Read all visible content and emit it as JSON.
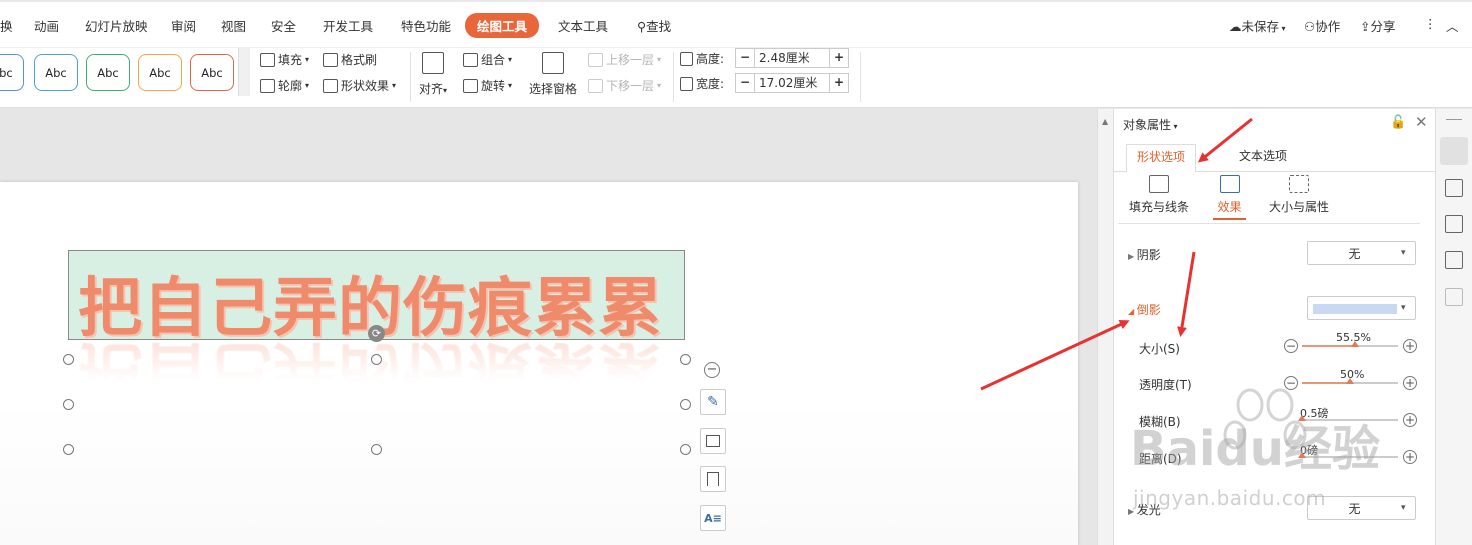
{
  "menubar": {
    "items": [
      {
        "label": "换"
      },
      {
        "label": "动画"
      },
      {
        "label": "幻灯片放映"
      },
      {
        "label": "审阅"
      },
      {
        "label": "视图"
      },
      {
        "label": "安全"
      },
      {
        "label": "开发工具"
      },
      {
        "label": "特色功能"
      },
      {
        "label": "绘图工具",
        "active": true
      },
      {
        "label": "文本工具"
      },
      {
        "label": "查找",
        "icon": "search-icon"
      }
    ],
    "right": {
      "unsaved": "未保存",
      "collab": "协作",
      "share": "分享",
      "more": "⋮",
      "collapse": "︿"
    },
    "accent_color": "#e8663a"
  },
  "ribbon": {
    "style_boxes": [
      {
        "label": "Abc",
        "color": "#5b8def"
      },
      {
        "label": "Abc",
        "color": "#4aa3c9"
      },
      {
        "label": "Abc",
        "color": "#39b07a"
      },
      {
        "label": "Abc",
        "color": "#f0a940"
      },
      {
        "label": "Abc",
        "color": "#e0664b"
      }
    ],
    "fill": "填充",
    "format_painter": "格式刷",
    "outline": "轮廓",
    "shape_effects": "形状效果",
    "align": "对齐",
    "group": "组合",
    "rotate": "旋转",
    "selection_pane": "选择窗格",
    "bring_forward": "上移一层",
    "send_backward": "下移一层",
    "height_label": "高度:",
    "height_value": "2.48厘米",
    "width_label": "宽度:",
    "width_value": "17.02厘米",
    "minus": "−",
    "plus": "+"
  },
  "canvas": {
    "text": "把自己弄的伤痕累累",
    "text_color": "#ef8a6b",
    "box_fill": "#d8efe4"
  },
  "panel": {
    "title": "对象属性",
    "tabs": {
      "shape": "形状选项",
      "text": "文本选项"
    },
    "subtabs": {
      "fill_line": "填充与线条",
      "effects": "效果",
      "size_props": "大小与属性"
    },
    "shadow": {
      "label": "阴影",
      "value": "无"
    },
    "reflection": {
      "label": "倒影",
      "swatch_color": "#c9d8f3",
      "size": {
        "label": "大小(S)",
        "value": "55.5%",
        "fraction": 0.555
      },
      "transparency": {
        "label": "透明度(T)",
        "value": "50%",
        "fraction": 0.5
      },
      "blur": {
        "label": "模糊(B)",
        "value": "0.5磅",
        "fraction": 0.0
      },
      "distance": {
        "label": "距离(D)",
        "value": "0磅",
        "fraction": 0.0
      }
    },
    "glow": {
      "label": "发光",
      "value": "无"
    }
  },
  "watermark": {
    "brand": "Baidu经验",
    "url": "jingyan.baidu.com"
  },
  "annotation_color": "#e83232"
}
